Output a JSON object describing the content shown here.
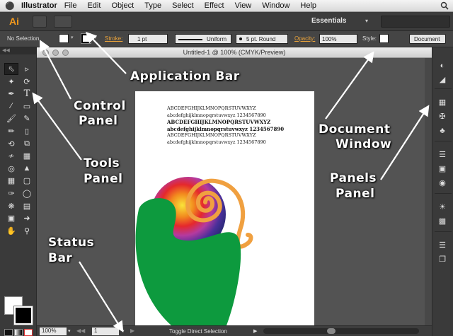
{
  "menubar": {
    "app_name": "Illustrator",
    "items": [
      "File",
      "Edit",
      "Object",
      "Type",
      "Select",
      "Effect",
      "View",
      "Window",
      "Help"
    ]
  },
  "appbar": {
    "logo": "Ai",
    "workspace": "Essentials"
  },
  "control": {
    "selection": "No Selection",
    "stroke_label": "Stroke:",
    "stroke_weight": "1 pt",
    "profile": "Uniform",
    "brush": "5 pt. Round",
    "opacity_label": "Opacity:",
    "opacity": "100%",
    "style_label": "Style:",
    "doc_setup": "Document Setup"
  },
  "document": {
    "title": "Untitled-1 @ 100% (CMYK/Preview)",
    "type_lines": [
      "ABCDEFGHIJKLMNOPQRSTUVWXYZ",
      "abcdefghijklmnopqrstuvwxyz 1234567890",
      "ABCDEFGHIJKLMNOPQRSTUVWXYZ",
      "abcdefghijklmnopqrstuvwxyz 1234567890",
      "ABCDEFGHIJKLMNOPQRSTUVWXYZ",
      "abcdefghijklmnopqrstuvwxyz 1234567890"
    ]
  },
  "status": {
    "zoom": "100%",
    "page": "1",
    "text": "Toggle Direct Selection"
  },
  "annotations": {
    "application_bar": "Application Bar",
    "control_panel_1": "Control",
    "control_panel_2": "Panel",
    "tools_panel_1": "Tools",
    "tools_panel_2": "Panel",
    "document_window_1": "Document",
    "document_window_2": "Window",
    "panels_panel_1": "Panels",
    "panels_panel_2": "Panel",
    "status_bar_1": "Status",
    "status_bar_2": "Bar"
  },
  "colors": {
    "accent_orange": "#f49a1d",
    "shape_green": "#0d9a3e",
    "spiral_orange": "#f0a040",
    "app_background": "#535353"
  },
  "icons": {
    "tools": [
      "selection-tool-icon",
      "direct-selection-tool-icon",
      "magic-wand-tool-icon",
      "lasso-tool-icon",
      "pen-tool-icon",
      "type-tool-icon",
      "line-tool-icon",
      "rectangle-tool-icon",
      "paintbrush-tool-icon",
      "pencil-tool-icon",
      "blob-brush-tool-icon",
      "eraser-tool-icon",
      "rotate-tool-icon",
      "scale-tool-icon",
      "width-tool-icon",
      "free-transform-tool-icon",
      "shape-builder-tool-icon",
      "perspective-grid-tool-icon",
      "mesh-tool-icon",
      "gradient-tool-icon",
      "eyedropper-tool-icon",
      "blend-tool-icon",
      "symbol-sprayer-tool-icon",
      "column-graph-tool-icon",
      "artboard-tool-icon",
      "slice-tool-icon",
      "hand-tool-icon",
      "zoom-tool-icon"
    ]
  }
}
